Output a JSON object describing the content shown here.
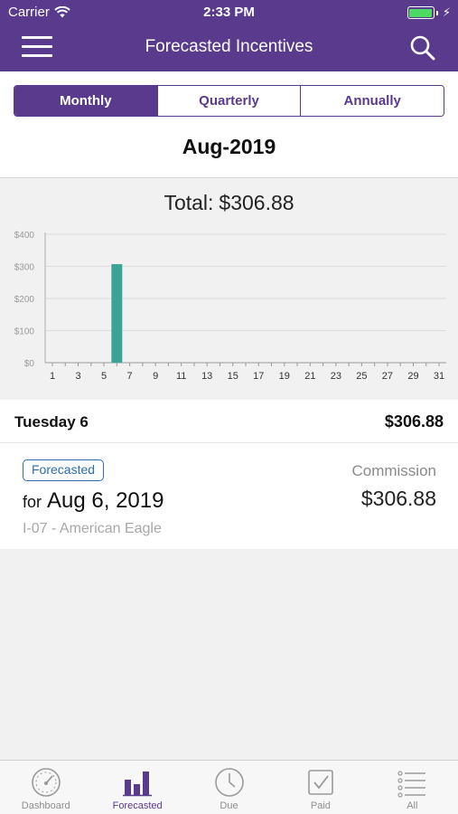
{
  "status_bar": {
    "carrier": "Carrier",
    "time": "2:33 PM"
  },
  "nav": {
    "title": "Forecasted Incentives"
  },
  "segments": [
    {
      "label": "Monthly",
      "active": true
    },
    {
      "label": "Quarterly",
      "active": false
    },
    {
      "label": "Annually",
      "active": false
    }
  ],
  "period": {
    "label": "Aug-2019"
  },
  "summary": {
    "total_label": "Total:",
    "total_value": "$306.88"
  },
  "chart_data": {
    "type": "bar",
    "x_ticks": [
      1,
      3,
      5,
      7,
      9,
      11,
      13,
      15,
      17,
      19,
      21,
      23,
      25,
      27,
      29,
      31
    ],
    "x_range": [
      1,
      31
    ],
    "y_ticks": [
      "$0",
      "$100",
      "$200",
      "$300",
      "$400"
    ],
    "ylim": [
      0,
      400
    ],
    "points": [
      {
        "day": 6,
        "value": 306.88
      }
    ],
    "bar_color": "#3aa596",
    "grid": true
  },
  "day_summary": {
    "label": "Tuesday 6",
    "amount": "$306.88"
  },
  "incentive": {
    "status_badge": "Forecasted",
    "for_label": "for",
    "date": "Aug 6, 2019",
    "item": "I-07 - American Eagle",
    "type_label": "Commission",
    "amount": "$306.88"
  },
  "tabbar": {
    "items": [
      {
        "label": "Dashboard",
        "icon": "gauge-icon",
        "active": false
      },
      {
        "label": "Forecasted",
        "icon": "bar-chart-icon",
        "active": true
      },
      {
        "label": "Due",
        "icon": "clock-icon",
        "active": false
      },
      {
        "label": "Paid",
        "icon": "checkbox-icon",
        "active": false
      },
      {
        "label": "All",
        "icon": "list-icon",
        "active": false
      }
    ]
  },
  "colors": {
    "brand": "#5a3a8c",
    "bar": "#3aa596",
    "badge": "#2d6bb0"
  }
}
